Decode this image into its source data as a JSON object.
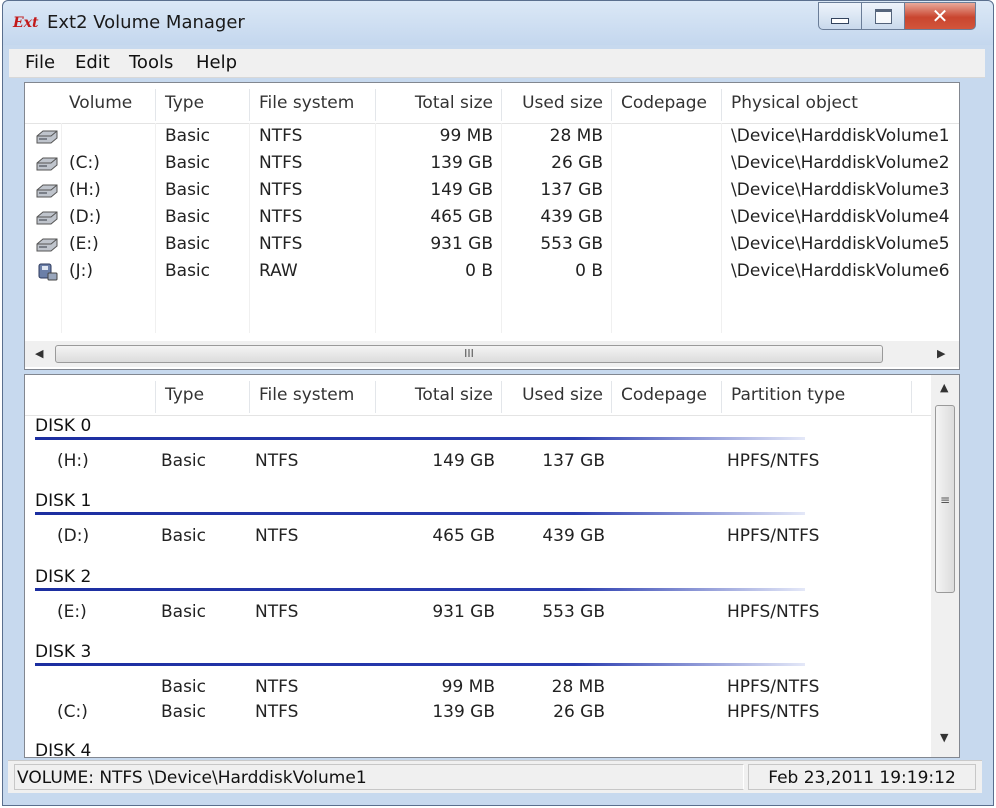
{
  "window": {
    "title": "Ext2 Volume Manager",
    "icon_text": "Ext"
  },
  "menu": [
    "File",
    "Edit",
    "Tools",
    "Help"
  ],
  "volumes": {
    "columns": [
      "Volume",
      "Type",
      "File system",
      "Total size",
      "Used size",
      "Codepage",
      "Physical object"
    ],
    "rows": [
      {
        "volume": "",
        "type": "Basic",
        "fs": "NTFS",
        "total": "99 MB",
        "used": "28 MB",
        "codepage": "",
        "physical": "\\Device\\HarddiskVolume1",
        "icon": "hard-disk-icon"
      },
      {
        "volume": "(C:)",
        "type": "Basic",
        "fs": "NTFS",
        "total": "139 GB",
        "used": "26 GB",
        "codepage": "",
        "physical": "\\Device\\HarddiskVolume2",
        "icon": "hard-disk-icon"
      },
      {
        "volume": "(H:)",
        "type": "Basic",
        "fs": "NTFS",
        "total": "149 GB",
        "used": "137 GB",
        "codepage": "",
        "physical": "\\Device\\HarddiskVolume3",
        "icon": "hard-disk-icon"
      },
      {
        "volume": "(D:)",
        "type": "Basic",
        "fs": "NTFS",
        "total": "465 GB",
        "used": "439 GB",
        "codepage": "",
        "physical": "\\Device\\HarddiskVolume4",
        "icon": "hard-disk-icon"
      },
      {
        "volume": "(E:)",
        "type": "Basic",
        "fs": "NTFS",
        "total": "931 GB",
        "used": "553 GB",
        "codepage": "",
        "physical": "\\Device\\HarddiskVolume5",
        "icon": "hard-disk-icon"
      },
      {
        "volume": "(J:)",
        "type": "Basic",
        "fs": "RAW",
        "total": "0 B",
        "used": "0 B",
        "codepage": "",
        "physical": "\\Device\\HarddiskVolume6",
        "icon": "usb-disk-icon"
      }
    ],
    "hscroll_grip": "III"
  },
  "disks": {
    "columns": [
      "",
      "Type",
      "File system",
      "Total size",
      "Used size",
      "Codepage",
      "Partition type"
    ],
    "groups": [
      {
        "title": "DISK 0",
        "partitions": [
          {
            "volume": "(H:)",
            "type": "Basic",
            "fs": "NTFS",
            "total": "149 GB",
            "used": "137 GB",
            "ptype": "HPFS/NTFS"
          }
        ]
      },
      {
        "title": "DISK 1",
        "partitions": [
          {
            "volume": "(D:)",
            "type": "Basic",
            "fs": "NTFS",
            "total": "465 GB",
            "used": "439 GB",
            "ptype": "HPFS/NTFS"
          }
        ]
      },
      {
        "title": "DISK 2",
        "partitions": [
          {
            "volume": "(E:)",
            "type": "Basic",
            "fs": "NTFS",
            "total": "931 GB",
            "used": "553 GB",
            "ptype": "HPFS/NTFS"
          }
        ]
      },
      {
        "title": "DISK 3",
        "partitions": [
          {
            "volume": "",
            "type": "Basic",
            "fs": "NTFS",
            "total": "99 MB",
            "used": "28 MB",
            "ptype": "HPFS/NTFS"
          },
          {
            "volume": "(C:)",
            "type": "Basic",
            "fs": "NTFS",
            "total": "139 GB",
            "used": "26 GB",
            "ptype": "HPFS/NTFS"
          }
        ]
      },
      {
        "title": "DISK 4",
        "partitions": []
      }
    ],
    "vscroll_grip": "≡"
  },
  "status": {
    "left": "VOLUME:  NTFS \\Device\\HarddiskVolume1",
    "right": "Feb 23,2011 19:19:12"
  },
  "colors": {
    "titlebar": "#c4d7ee",
    "close_button": "#c9452f",
    "group_line": "#1c2ea0"
  }
}
